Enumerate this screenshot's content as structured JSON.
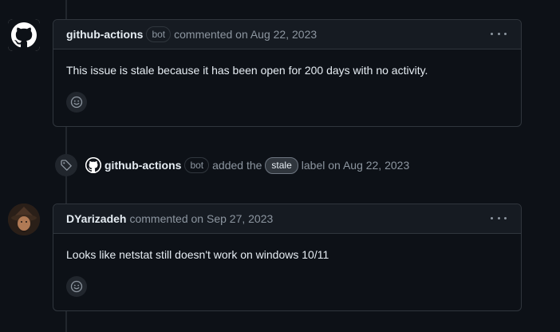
{
  "comments": [
    {
      "author": "github-actions",
      "badge": "bot",
      "meta": "commented on Aug 22, 2023",
      "body": "This issue is stale because it has been open for 200 days with no activity.",
      "avatar_icon": "github-logo-icon"
    },
    {
      "author": "DYarizadeh",
      "meta": "commented on Sep 27, 2023",
      "body": "Looks like netstat still doesn't work on windows 10/11",
      "avatar_icon": "user-avatar"
    }
  ],
  "event": {
    "icon": "tag-icon",
    "author": "github-actions",
    "badge": "bot",
    "action": "added the",
    "label": "stale",
    "suffix": "label on Aug 22, 2023"
  },
  "colors": {
    "background": "#0d1117",
    "header": "#161b22",
    "border": "#30363d",
    "muted": "#8d96a0",
    "text": "#e6edf3"
  }
}
